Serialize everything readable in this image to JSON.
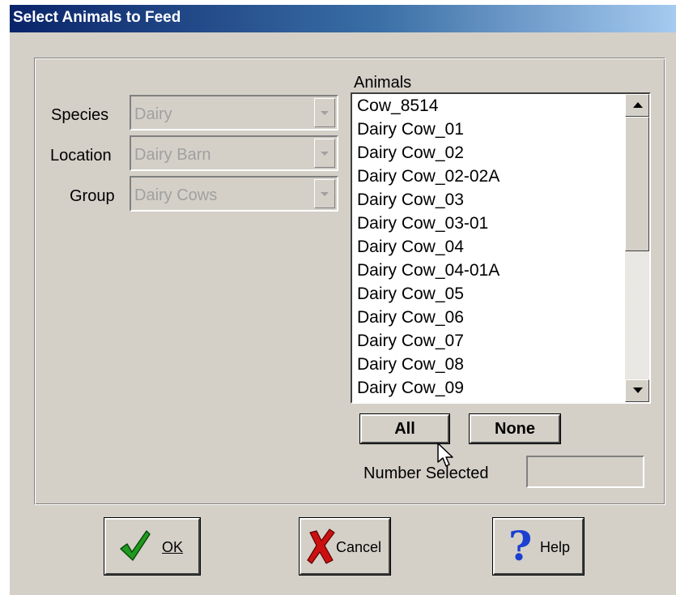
{
  "window": {
    "title": "Select Animals to Feed"
  },
  "filters": {
    "species": {
      "label": "Species",
      "value": "Dairy"
    },
    "location": {
      "label": "Location",
      "value": "Dairy Barn"
    },
    "group": {
      "label": "Group",
      "value": "Dairy Cows"
    }
  },
  "animals": {
    "label": "Animals",
    "items": [
      "Cow_8514",
      "Dairy Cow_01",
      "Dairy Cow_02",
      "Dairy Cow_02-02A",
      "Dairy Cow_03",
      "Dairy Cow_03-01",
      "Dairy Cow_04",
      "Dairy Cow_04-01A",
      "Dairy Cow_05",
      "Dairy Cow_06",
      "Dairy Cow_07",
      "Dairy Cow_08",
      "Dairy Cow_09"
    ]
  },
  "selection": {
    "all_label": "All",
    "none_label": "None",
    "number_selected_label": "Number Selected",
    "number_selected_value": ""
  },
  "buttons": {
    "ok": "OK",
    "cancel": "Cancel",
    "help": "Help"
  },
  "icons": {
    "ok": "checkmark-icon",
    "cancel": "x-icon",
    "help": "question-icon",
    "cursor": "mouse-pointer-icon"
  },
  "colors": {
    "title_start": "#0a246a",
    "title_end": "#a6caf0",
    "face": "#d4d0c8",
    "ok_green": "#1f9a1f",
    "cancel_red": "#cc1010",
    "help_blue": "#1c3fd0"
  }
}
